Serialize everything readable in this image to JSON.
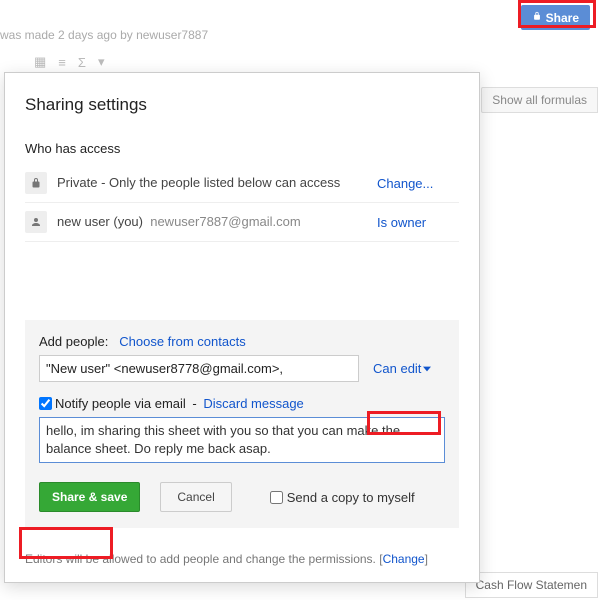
{
  "topbar": {
    "info_text": "was made 2 days ago by newuser7887",
    "share_label": "Share"
  },
  "rightpanel": {
    "show_formulas": "Show all formulas",
    "sheet_tab": "Cash Flow Statemen"
  },
  "dialog": {
    "title": "Sharing settings",
    "who_label": "Who has access",
    "rows": [
      {
        "text": "Private - Only the people listed below can access",
        "action": "Change..."
      },
      {
        "text": "new user (you)",
        "email": "newuser7887@gmail.com",
        "status": "Is owner"
      }
    ],
    "add": {
      "label": "Add people:",
      "contacts": "Choose from contacts",
      "value": "\"New user\" <newuser8778@gmail.com>,",
      "perm": "Can edit",
      "notify": "Notify people via email",
      "discard": "Discard message",
      "message": "hello, im sharing this sheet with you so that you can make the balance sheet. Do reply me back asap.",
      "share_save": "Share & save",
      "cancel": "Cancel",
      "copy_self": "Send a copy to myself"
    },
    "footer": {
      "text": "Editors will be allowed to add people and change the permissions.",
      "change": "Change"
    }
  }
}
